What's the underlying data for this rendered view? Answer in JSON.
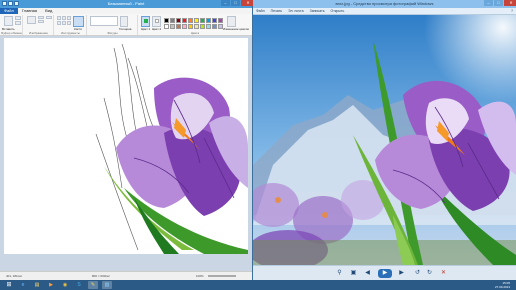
{
  "paint": {
    "title": "Безымянный - Paint",
    "tabs": [
      "Файл",
      "Главная",
      "Вид"
    ],
    "groups": [
      "Буфер обмена",
      "Изображение",
      "Инструменты",
      "Фигуры",
      "Цвета"
    ],
    "tool_labels": {
      "paste": "Вставить",
      "brushes": "Кисти",
      "thickness": "Толщина",
      "color1": "Цвет 1",
      "color2": "Цвет 2",
      "edit_colors": "Изменение цветов"
    },
    "palette": [
      "#000000",
      "#7f7f7f",
      "#880015",
      "#ed1c24",
      "#ff7f27",
      "#fff200",
      "#22b14c",
      "#00a2e8",
      "#3f48cc",
      "#a349a4",
      "#ffffff",
      "#c3c3c3",
      "#b97a57",
      "#ffaec9",
      "#ffc90e",
      "#efe4b0",
      "#b5e61d",
      "#99d9ea",
      "#7092be",
      "#c8bfe7"
    ],
    "status": {
      "size": "800 × 600пкс",
      "zoom": "100%",
      "coords": "401, 181пкс"
    }
  },
  "viewer": {
    "title": "вгоx.jpg - Средство просмотра фотографий Windows",
    "menu": [
      "Файл",
      "Печать",
      "Эл. почта",
      "Записать",
      "Открыть"
    ]
  },
  "taskbar": {
    "apps": [
      "start",
      "ie",
      "explorer",
      "media",
      "chrome",
      "skype",
      "paint",
      "photos"
    ],
    "time": "15:06",
    "date": "27.09.2013"
  }
}
